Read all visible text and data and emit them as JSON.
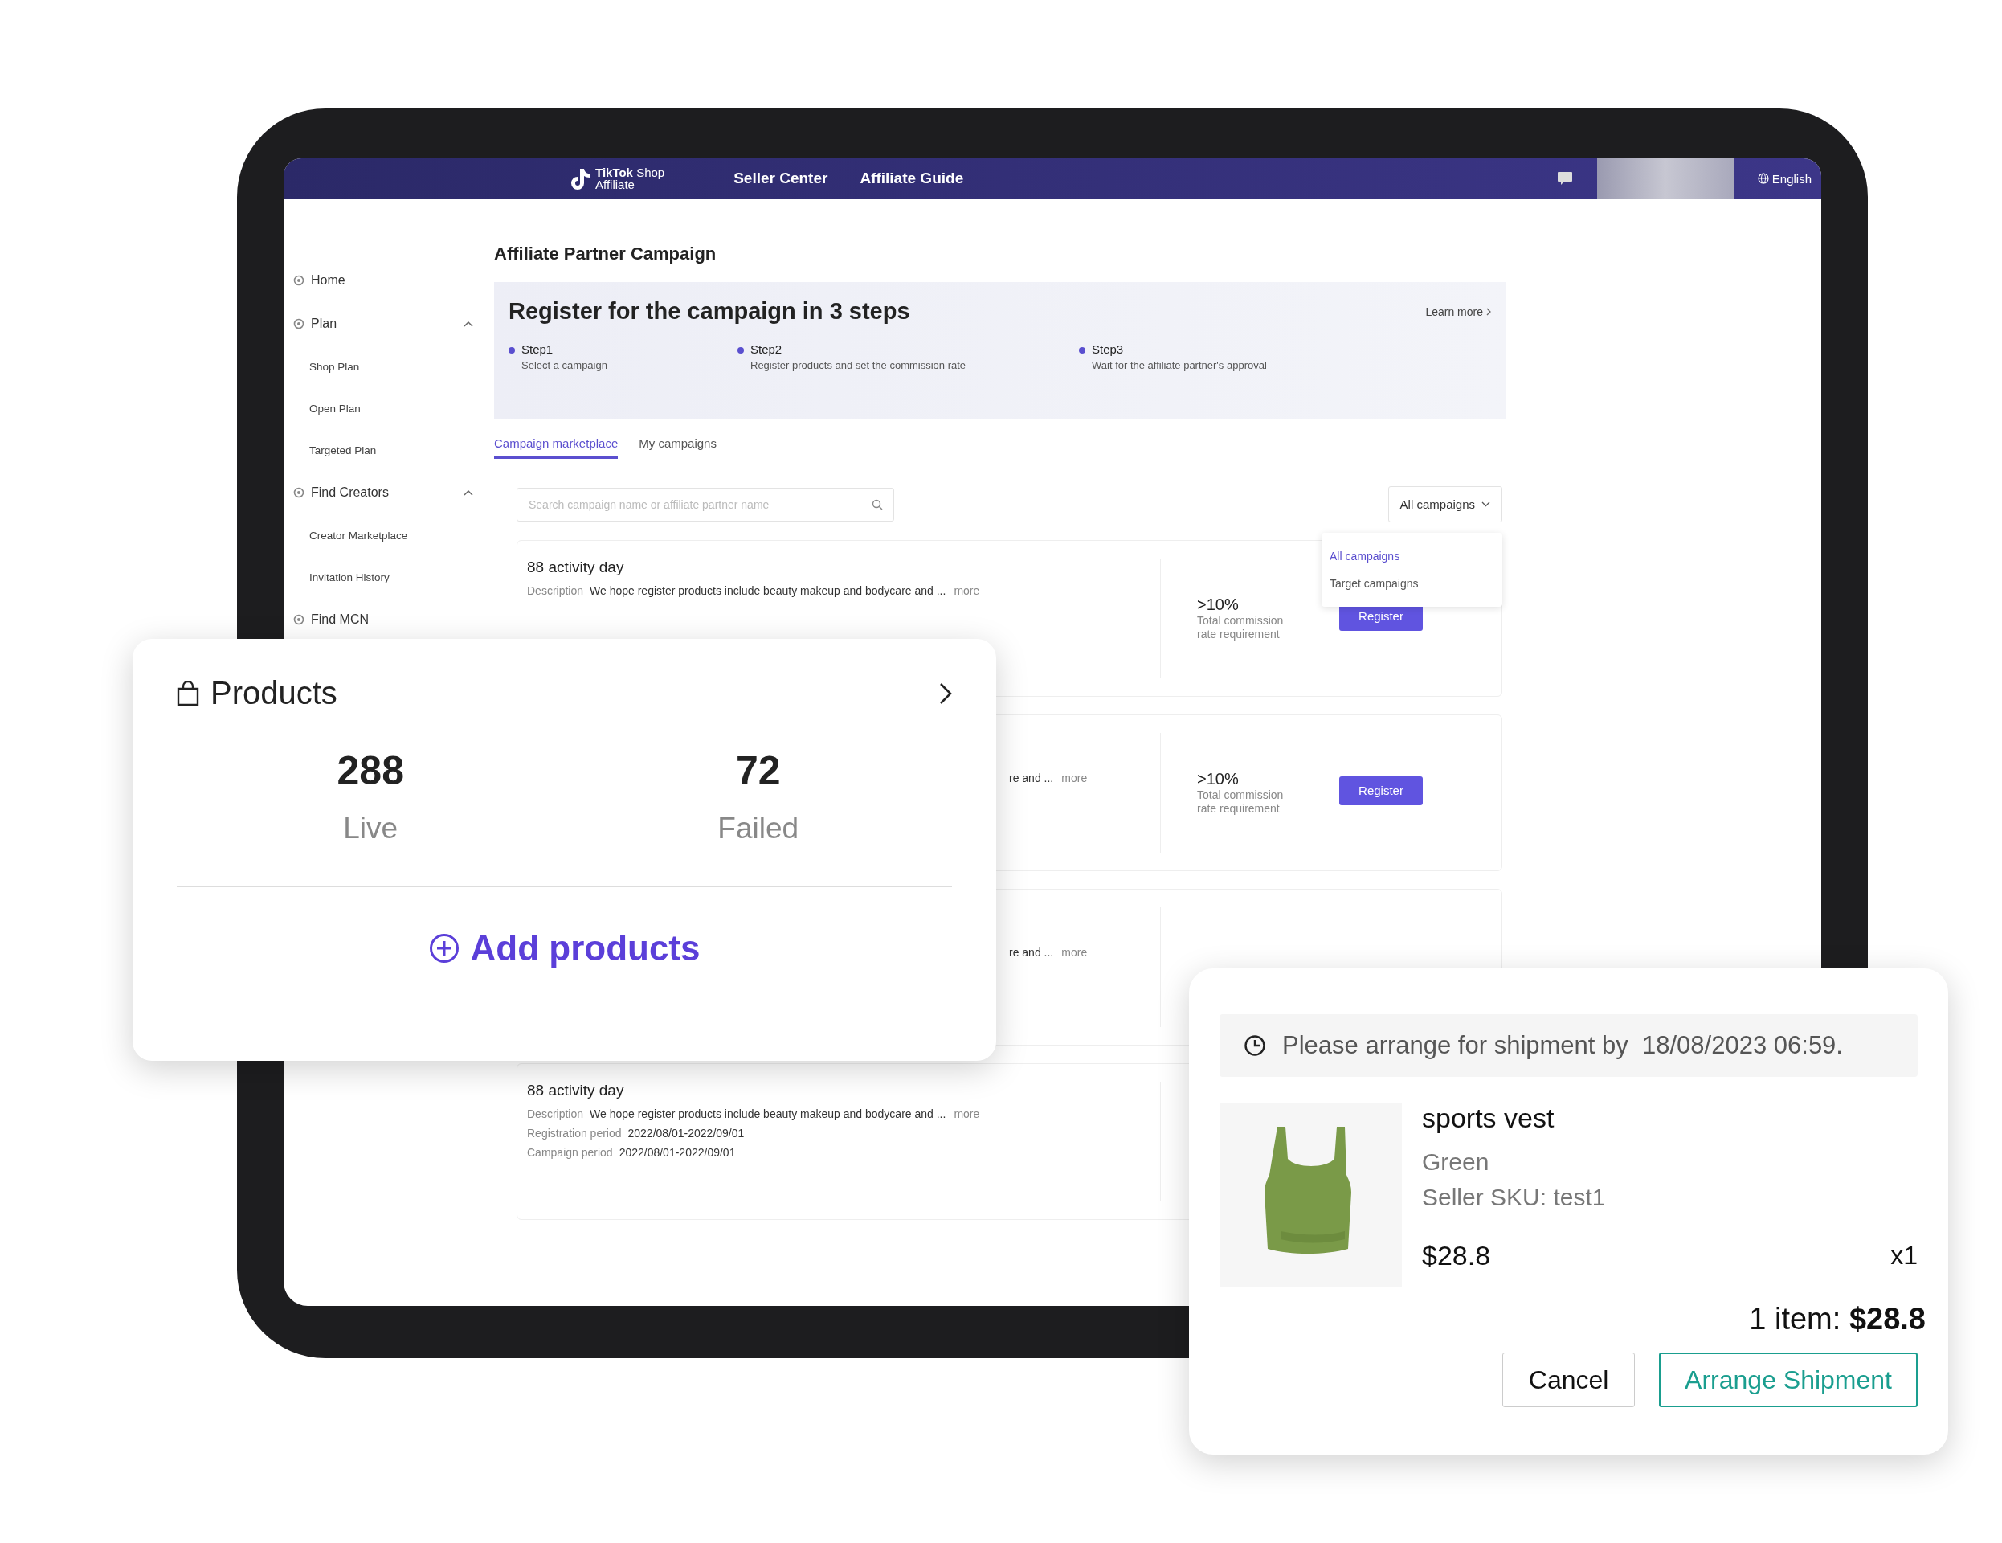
{
  "nav": {
    "logo_text": "**TikTok** Shop",
    "logo_subtext": "Affiliate",
    "links": [
      "Seller Center",
      "Affiliate Guide"
    ],
    "language": "English"
  },
  "sidebar": {
    "items": [
      {
        "label": "Home"
      },
      {
        "label": "Plan",
        "expanded": true,
        "children": [
          {
            "label": "Shop Plan"
          },
          {
            "label": "Open Plan"
          },
          {
            "label": "Targeted Plan"
          }
        ]
      },
      {
        "label": "Find Creators",
        "expanded": true,
        "children": [
          {
            "label": "Creator Marketplace"
          },
          {
            "label": "Invitation History"
          }
        ]
      },
      {
        "label": "Find MCN"
      }
    ]
  },
  "page_title": "Affiliate Partner Campaign",
  "banner": {
    "title": "Register for the campaign in 3 steps",
    "learn_more": "Learn more",
    "steps": [
      {
        "label": "Step1",
        "text": "Select a campaign"
      },
      {
        "label": "Step2",
        "text": "Register products and set the commission rate"
      },
      {
        "label": "Step3",
        "text": "Wait for the affiliate partner's approval"
      }
    ]
  },
  "tabs": [
    {
      "label": "Campaign marketplace",
      "selected": true
    },
    {
      "label": "My campaigns",
      "selected": false
    }
  ],
  "search": {
    "placeholder": "Search campaign name or affiliate partner name"
  },
  "filter": {
    "value": "All campaigns",
    "options": [
      {
        "label": "All campaigns",
        "selected": true
      },
      {
        "label": "Target campaigns",
        "selected": false
      }
    ]
  },
  "campaigns": [
    {
      "title": "88 activity day",
      "description_label": "Description",
      "description": "We hope register products include beauty makeup and bodycare and ...",
      "more": "more",
      "commission": ">10%",
      "commission_label": "Total commission rate requirement",
      "button": "Register"
    },
    {
      "description": "re and ...",
      "more": "more",
      "commission": ">10%",
      "commission_label": "Total commission rate requirement",
      "button": "Register"
    },
    {
      "description": "re and ...",
      "more": "more"
    },
    {
      "title": "88 activity day",
      "description_label": "Description",
      "description": "We hope register products include beauty makeup and bodycare and ...",
      "more": "more",
      "periods": [
        {
          "label": "Registration period",
          "value": "2022/08/01-2022/09/01"
        },
        {
          "label": "Campaign period",
          "value": "2022/08/01-2022/09/01"
        }
      ]
    }
  ],
  "products_card": {
    "title": "Products",
    "stats": [
      {
        "value": "288",
        "label": "Live"
      },
      {
        "value": "72",
        "label": "Failed"
      }
    ],
    "action": "Add products"
  },
  "shipment_card": {
    "notice": "Please arrange for shipment by  18/08/2023 06:59.",
    "product": {
      "kind": "picture",
      "name": "sports vest",
      "variant": "Green",
      "sku": "Seller SKU: test1",
      "price": "$28.8",
      "quantity": "x1"
    },
    "total": "1 item: **$28.8**",
    "buttons": [
      {
        "label": "Cancel",
        "kind": "secondary"
      },
      {
        "label": "Arrange Shipment",
        "kind": "primary"
      }
    ]
  }
}
